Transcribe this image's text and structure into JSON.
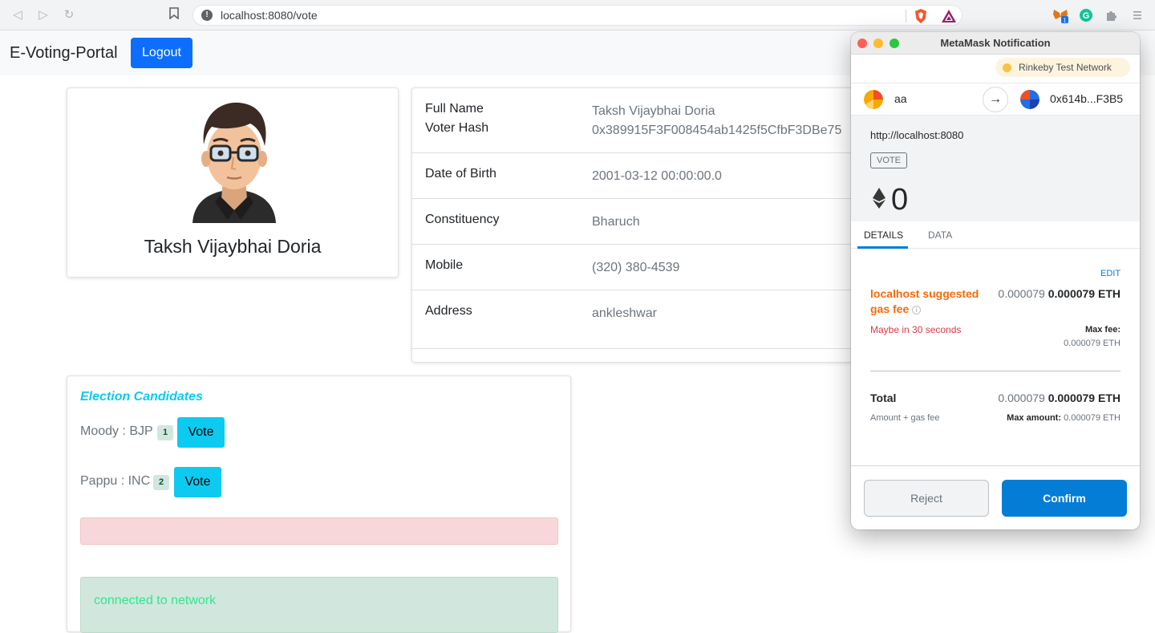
{
  "browser": {
    "url": "localhost:8080/vote",
    "extension_badge": "1"
  },
  "navbar": {
    "brand": "E-Voting-Portal",
    "logout_label": "Logout",
    "logout_color": "#0d6efd"
  },
  "profile": {
    "name": "Taksh Vijaybhai Doria"
  },
  "details": [
    {
      "label": "Full Name",
      "value": "Taksh Vijaybhai Doria"
    },
    {
      "label": "Voter Hash",
      "value": "0x389915F3F008454ab1425f5CfbF3DBe75"
    },
    {
      "label": "Date of Birth",
      "value": "2001-03-12 00:00:00.0"
    },
    {
      "label": "Constituency",
      "value": "Bharuch"
    },
    {
      "label": "Mobile",
      "value": "(320) 380-4539"
    },
    {
      "label": "Address",
      "value": "ankleshwar"
    }
  ],
  "candidates": {
    "title": "Election Candidates",
    "vote_label": "Vote",
    "items": [
      {
        "text": "Moody : BJP",
        "badge": "1"
      },
      {
        "text": "Pappu : INC",
        "badge": "2"
      }
    ],
    "status": "connected to network"
  },
  "metamask": {
    "title": "MetaMask Notification",
    "network": "Rinkeby Test Network",
    "from_account": "aa",
    "to_account": "0x614b...F3B5",
    "origin": "http://localhost:8080",
    "method": "VOTE",
    "amount": "0",
    "tabs": [
      "DETAILS",
      "DATA"
    ],
    "edit_label": "EDIT",
    "gas_label": "localhost suggested gas fee",
    "gas_value_muted": "0.000079",
    "gas_value_bold": "0.000079 ETH",
    "timing": "Maybe in 30 seconds",
    "max_fee_label": "Max fee:",
    "max_fee_value": "0.000079 ETH",
    "total_label": "Total",
    "total_value_muted": "0.000079",
    "total_value_bold": "0.000079 ETH",
    "amount_gas_label": "Amount + gas fee",
    "max_amount_label": "Max amount:",
    "max_amount_value": "0.000079 ETH",
    "reject_label": "Reject",
    "confirm_label": "Confirm",
    "accent_color": "#037dd6"
  }
}
